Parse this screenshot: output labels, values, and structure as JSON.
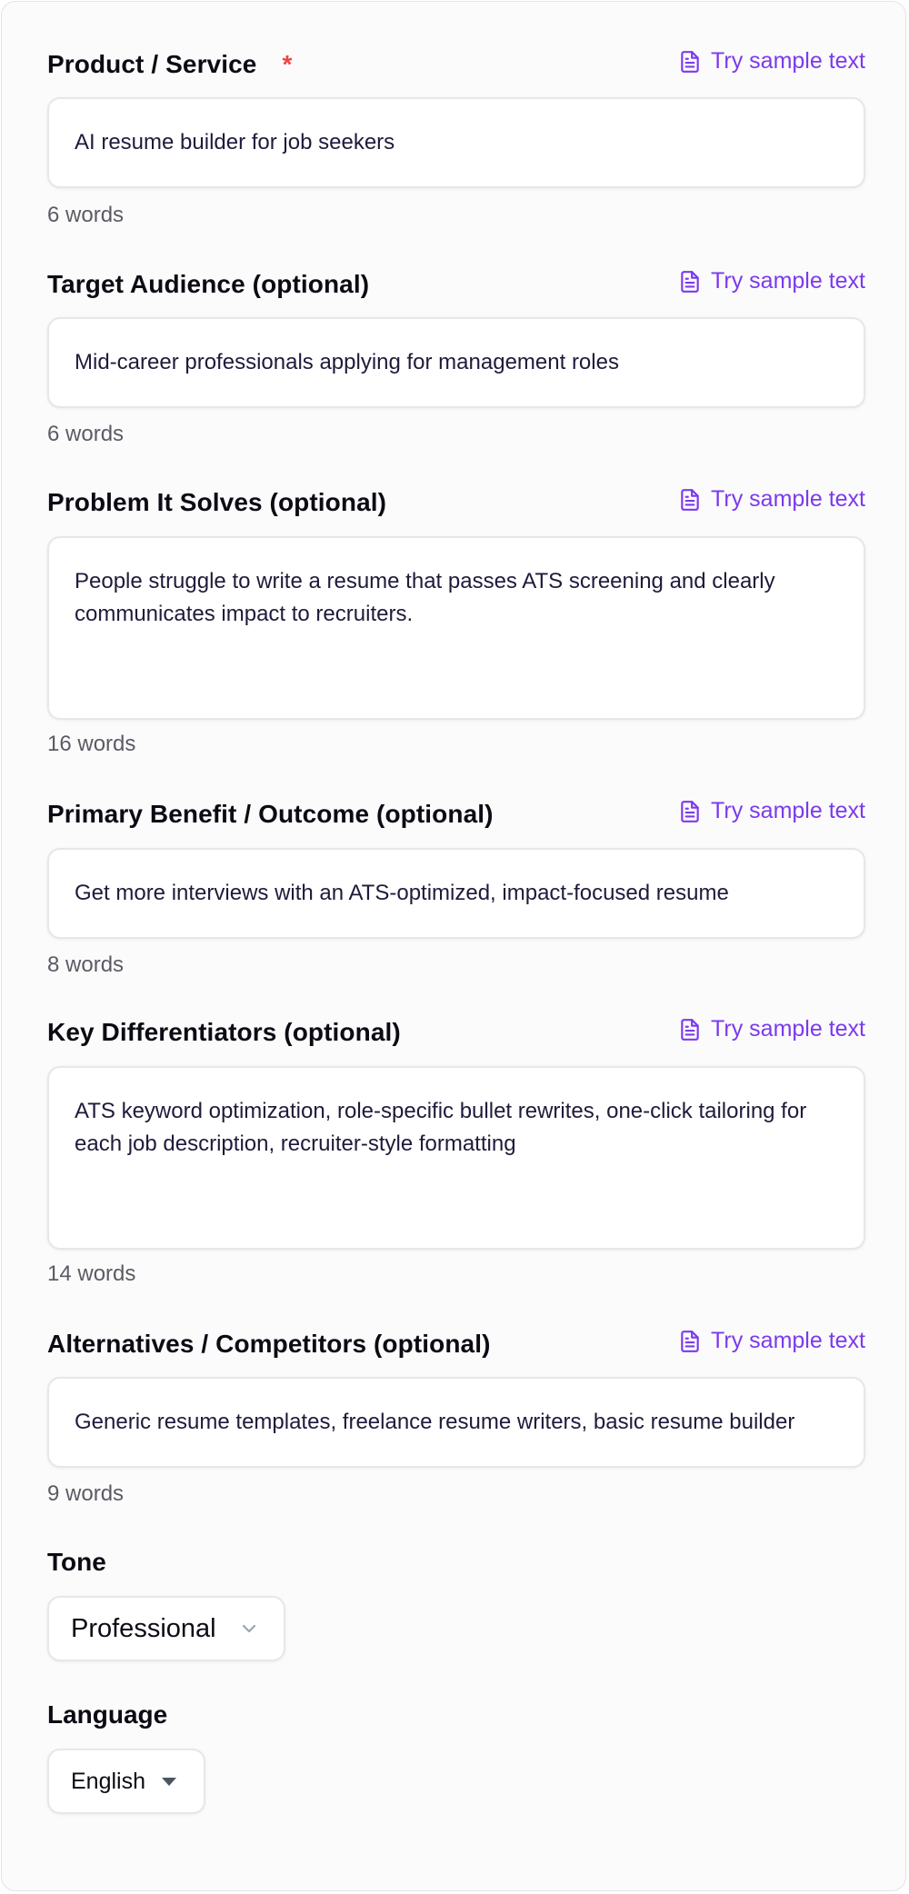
{
  "fields": [
    {
      "label": "Product / Service",
      "required_mark": "*",
      "sample_label": "Try sample text",
      "value": "AI resume builder for job seekers",
      "word_count": "6 words"
    },
    {
      "label": "Target Audience (optional)",
      "sample_label": "Try sample text",
      "value": "Mid-career professionals applying for management roles",
      "word_count": "6 words"
    },
    {
      "label": "Problem It Solves (optional)",
      "sample_label": "Try sample text",
      "value": "People struggle to write a resume that passes ATS screening and clearly communicates impact to recruiters.",
      "word_count": "16 words"
    },
    {
      "label": "Primary Benefit / Outcome (optional)",
      "sample_label": "Try sample text",
      "value": "Get more interviews with an ATS-optimized, impact-focused resume",
      "word_count": "8 words"
    },
    {
      "label": "Key Differentiators (optional)",
      "sample_label": "Try sample text",
      "value": "ATS keyword optimization, role-specific bullet rewrites, one-click tailoring for each job description, recruiter-style formatting",
      "word_count": "14 words"
    },
    {
      "label": "Alternatives / Competitors (optional)",
      "sample_label": "Try sample text",
      "value": "Generic resume templates, freelance resume writers, basic resume builder",
      "word_count": "9 words"
    }
  ],
  "tone": {
    "label": "Tone",
    "value": "Professional"
  },
  "language": {
    "label": "Language",
    "value": "English"
  },
  "colors": {
    "accent": "#7c3aed",
    "required": "#ef4444",
    "muted": "#5b5b66"
  },
  "icons": {
    "sample": "document-icon",
    "tone_chevron": "chevron-down-icon",
    "language_caret": "caret-down-icon"
  }
}
